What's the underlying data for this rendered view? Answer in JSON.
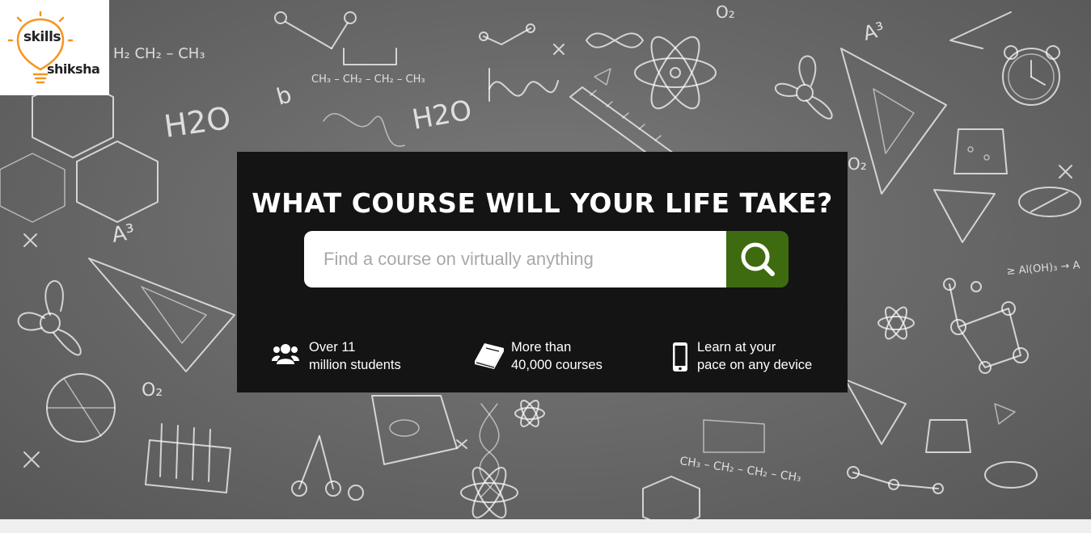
{
  "brand": {
    "line1": "skills",
    "line2": "shiksha",
    "accent_color": "#f7941d"
  },
  "hero": {
    "headline": "What course will your life take?",
    "search": {
      "placeholder": "Find a course on virtually anything",
      "value": "",
      "button_icon": "search-icon",
      "button_color": "#3e6b0f"
    },
    "background": "chalkboard-science-doodles"
  },
  "doodle_text": {
    "formula_top": "H₂  CH₂ – CH₃",
    "formula_mid": "CH₃ – CH₂ – CH₂ – CH₃",
    "h2o_left": "H2O",
    "h2o_mid": "H2O",
    "a3_left": "A³",
    "a3_right": "A³",
    "o2_top": "O₂",
    "o2_left": "O₂",
    "o2_right": "O₂",
    "formula_bottom": "CH₃ – CH₂ – CH₂ – CH₃",
    "eq_right": "≥ Al(OH)₃ → A",
    "b_left": "b"
  },
  "features": [
    {
      "icon": "users-icon",
      "line1": "Over 11",
      "line2": "million students"
    },
    {
      "icon": "book-icon",
      "line1": "More than",
      "line2": "40,000 courses"
    },
    {
      "icon": "mobile-phone-icon",
      "line1": "Learn at your",
      "line2": "pace on any device"
    }
  ]
}
